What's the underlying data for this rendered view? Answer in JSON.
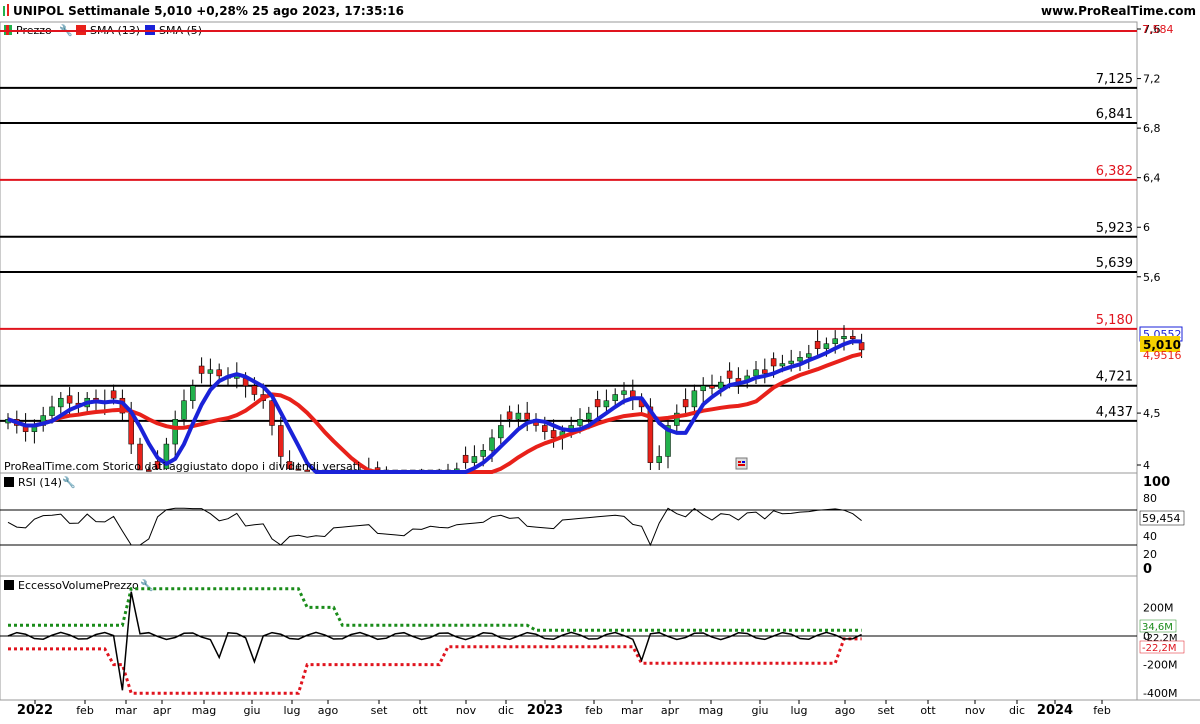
{
  "header": {
    "title": "UNIPOL Settimanale 5,010 +0,28% 25 ago 2023, 17:35:16",
    "site": "www.ProRealTime.com"
  },
  "colors": {
    "up": "#22b14c",
    "down": "#e8211a",
    "sma13": "#e8211a",
    "sma5": "#1a22d8",
    "fib_red": "#e0141e",
    "fib_black": "#000000",
    "price_tag": "#f5d000"
  },
  "price_panel": {
    "legend": [
      {
        "label": "Prezzo",
        "color": "#22b14c",
        "icon": "candles-icon"
      },
      {
        "label": "SMA (13)",
        "color": "#e8211a",
        "icon": "square-icon"
      },
      {
        "label": "SMA (5)",
        "color": "#1a22d8",
        "icon": "square-icon"
      }
    ],
    "watermark": "ProRealTime.com  Storico dati aggiustato dopo i dividendi versati",
    "last_price": "5,010",
    "sma5_value": "5,0552",
    "sma13_value": "4,9516",
    "top_level_label": "7,584"
  },
  "rsi_panel": {
    "legend": "RSI (14)",
    "value": "59,454"
  },
  "volume_panel": {
    "legend": "EccessoVolumePrezzo",
    "value_green": "34,6M",
    "value_black": "-22,2M",
    "value_red": "-22,2M"
  },
  "chart_data": [
    {
      "type": "candlestick",
      "title": "UNIPOL Settimanale",
      "ylim": [
        3.9,
        7.65
      ],
      "y_ticks": [
        "7,6",
        "7,2",
        "6,8",
        "6,4",
        "6",
        "5,6",
        "4,5",
        "4"
      ],
      "x_ticks": [
        "2022",
        "feb",
        "mar",
        "apr",
        "mag",
        "giu",
        "lug",
        "ago",
        "set",
        "ott",
        "nov",
        "dic",
        "2023",
        "feb",
        "mar",
        "apr",
        "mag",
        "giu",
        "lug",
        "ago",
        "set",
        "ott",
        "nov",
        "dic",
        "2024",
        "feb"
      ],
      "levels": [
        {
          "value": 7.584,
          "label": "",
          "color": "red"
        },
        {
          "value": 7.125,
          "label": "7,125",
          "color": "black"
        },
        {
          "value": 6.841,
          "label": "6,841",
          "color": "black"
        },
        {
          "value": 6.382,
          "label": "6,382",
          "color": "red"
        },
        {
          "value": 5.923,
          "label": "5,923",
          "color": "black"
        },
        {
          "value": 5.639,
          "label": "5,639",
          "color": "black"
        },
        {
          "value": 5.18,
          "label": "5,180",
          "color": "red"
        },
        {
          "value": 4.721,
          "label": "4,721",
          "color": "black"
        },
        {
          "value": 4.437,
          "label": "4,437",
          "color": "black"
        }
      ],
      "close_approx": [
        4.45,
        4.4,
        4.35,
        4.4,
        4.48,
        4.55,
        4.62,
        4.58,
        4.55,
        4.62,
        4.6,
        4.58,
        4.62,
        4.5,
        4.25,
        4.0,
        3.9,
        4.05,
        4.25,
        4.45,
        4.6,
        4.72,
        4.82,
        4.85,
        4.8,
        4.78,
        4.82,
        4.72,
        4.65,
        4.6,
        4.4,
        4.15,
        4.05,
        3.98,
        3.9,
        3.85,
        3.8,
        3.85,
        3.9,
        3.95,
        4.0,
        4.05,
        4.0,
        3.95,
        3.9,
        3.85,
        3.88,
        3.9,
        3.95,
        3.98,
        4.0,
        4.05,
        4.1,
        4.15,
        4.2,
        4.3,
        4.4,
        4.45,
        4.5,
        4.45,
        4.4,
        4.35,
        4.3,
        4.35,
        4.4,
        4.45,
        4.5,
        4.55,
        4.6,
        4.65,
        4.68,
        4.62,
        4.55,
        4.1,
        4.15,
        4.4,
        4.5,
        4.55,
        4.68,
        4.72,
        4.7,
        4.75,
        4.78,
        4.75,
        4.8,
        4.85,
        4.82,
        4.88,
        4.9,
        4.92,
        4.95,
        4.98,
        5.02,
        5.06,
        5.1,
        5.12,
        5.1,
        5.01
      ],
      "sma13_approx": [
        4.55,
        4.55,
        4.55,
        4.55,
        4.55,
        4.55,
        4.55,
        4.55,
        4.55,
        4.55,
        4.55,
        4.55,
        4.55,
        4.53,
        4.5,
        4.48,
        4.45,
        4.43,
        4.42,
        4.42,
        4.43,
        4.45,
        4.48,
        4.52,
        4.55,
        4.56,
        4.56,
        4.6,
        4.68,
        4.7,
        4.65,
        4.55,
        4.45,
        4.35,
        4.25,
        4.2,
        4.15,
        4.1,
        4.05,
        4.02,
        4.0,
        3.98,
        3.95
      ],
      "note": "Price, SMA(13) and SMA(5) series over weekly candles Jan 2022 – Aug 2023"
    },
    {
      "type": "line",
      "title": "RSI (14)",
      "ylim": [
        0,
        100
      ],
      "y_ticks": [
        "100",
        "80",
        "60",
        "40",
        "20",
        "0"
      ],
      "guides": [
        70,
        30
      ]
    },
    {
      "type": "line",
      "title": "EccessoVolumePrezzo",
      "y_ticks": [
        "200M",
        "0",
        "-200M",
        "-400M"
      ]
    }
  ]
}
